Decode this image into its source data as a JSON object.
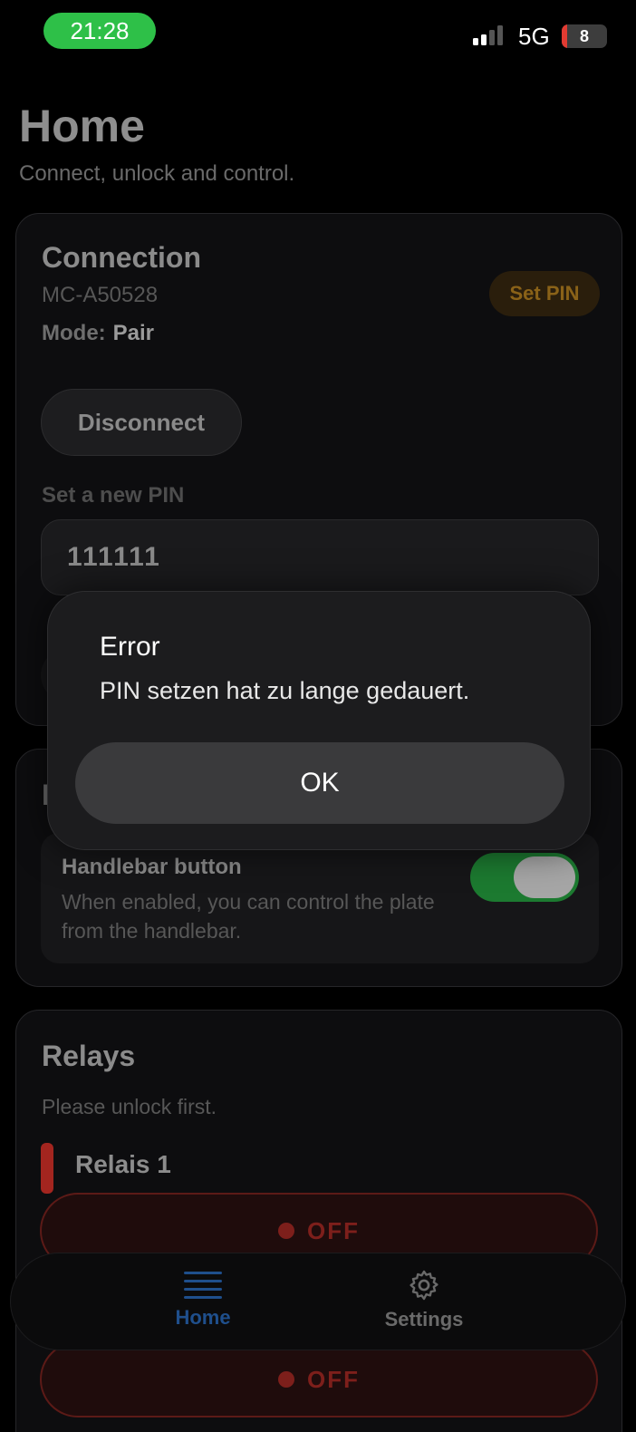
{
  "status_bar": {
    "time": "21:28",
    "network": "5G",
    "battery": "8"
  },
  "header": {
    "title": "Home",
    "subtitle": "Connect, unlock and control."
  },
  "connection": {
    "title": "Connection",
    "device_id": "MC-A50528",
    "mode_label": "Mode:",
    "mode_value": "Pair",
    "set_pin_badge": "Set PIN",
    "disconnect_label": "Disconnect",
    "new_pin_label": "Set a new PIN",
    "new_pin_value": "111111"
  },
  "controls": {
    "title_partial": "I",
    "handlebar": {
      "title": "Handlebar button",
      "description": "When enabled, you can control the plate from the handlebar.",
      "enabled": true
    }
  },
  "relays": {
    "title": "Relays",
    "subtitle": "Please unlock first.",
    "relay1": {
      "name": "Relais 1",
      "state": "OFF"
    },
    "relay2": {
      "state": "OFF"
    }
  },
  "tabbar": {
    "tabs": [
      {
        "label": "Home",
        "icon": "menu-icon",
        "active": true
      },
      {
        "label": "Settings",
        "icon": "gear-icon",
        "active": false
      }
    ]
  },
  "dialog": {
    "title": "Error",
    "message": "PIN setzen hat zu lange gedauert.",
    "ok_label": "OK"
  },
  "colors": {
    "background": "#000000",
    "status_green": "#2ec048",
    "accent_blue": "#1f4f8c",
    "toggle_on": "#1c7a30",
    "relay_off_red": "#7d1f1b",
    "set_pin_orange": "#8a6218"
  }
}
